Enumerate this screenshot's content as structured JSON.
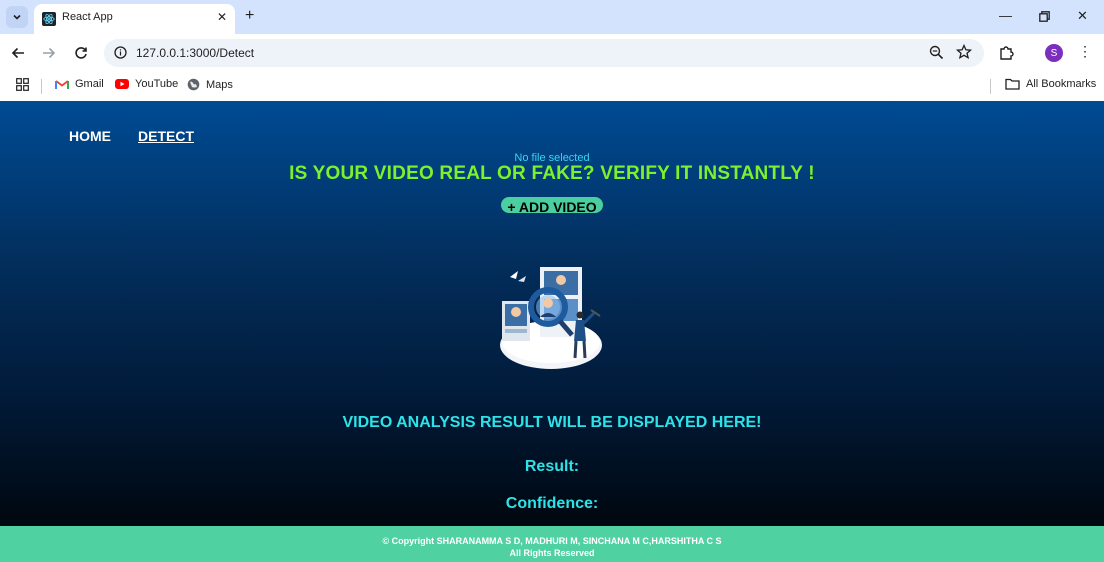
{
  "browser": {
    "tab_title": "React App",
    "url": "127.0.0.1:3000/Detect",
    "profile_initial": "S",
    "bookmarks": [
      {
        "label": "Gmail",
        "icon": "gmail-icon"
      },
      {
        "label": "YouTube",
        "icon": "youtube-icon"
      },
      {
        "label": "Maps",
        "icon": "maps-icon"
      }
    ],
    "all_bookmarks_label": "All Bookmarks"
  },
  "nav": {
    "home": "HOME",
    "detect": "DETECT"
  },
  "upload": {
    "file_status": "No file selected",
    "headline": "IS YOUR VIDEO REAL OR FAKE? VERIFY IT INSTANTLY !",
    "add_button": "+ ADD VIDEO"
  },
  "result": {
    "heading": "VIDEO ANALYSIS RESULT WILL BE DISPLAYED HERE!",
    "result_label": "Result:",
    "confidence_label": "Confidence:"
  },
  "footer": {
    "copyright": "© Copyright SHARANAMMA S D, MADHURI M, SINCHANA M C,HARSHITHA C S",
    "rights": "All Rights Reserved"
  },
  "colors": {
    "headline": "#7df22a",
    "result_text": "#2ee3e8",
    "button_bg": "#4ccfa0",
    "footer_bg": "#4fd1a1",
    "page_top": "#004b94",
    "page_bottom": "#00070f"
  }
}
